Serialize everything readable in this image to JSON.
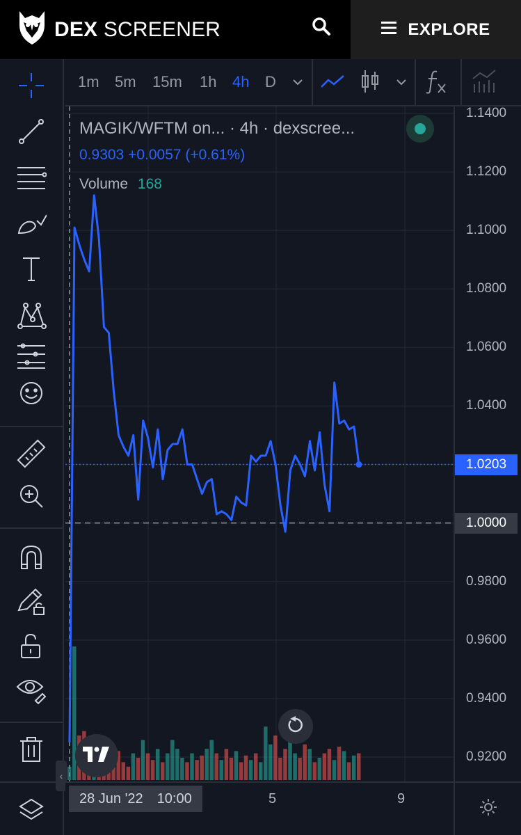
{
  "header": {
    "brand_bold": "DEX",
    "brand_light": "SCREENER",
    "explore_label": "EXPLORE"
  },
  "icons": {
    "logo": "owl-logo-icon",
    "search": "search-icon",
    "menu": "hamburger-menu-icon"
  },
  "toolbar": {
    "timeframes": [
      "1m",
      "5m",
      "15m",
      "1h",
      "4h",
      "D"
    ],
    "active_timeframe": "4h"
  },
  "legend": {
    "title": "MAGIK/WFTM on... · 4h · dexscree...",
    "price_line": "0.9303 +0.0057 (+0.61%)",
    "volume_label": "Volume",
    "volume_value": "168"
  },
  "price_axis": {
    "ticks": [
      "1.1400",
      "1.1200",
      "1.1000",
      "1.0800",
      "1.0600",
      "1.0400",
      "1.0200",
      "1.0000",
      "0.9800",
      "0.9600",
      "0.9400",
      "0.9200"
    ],
    "last_price_tag": "1.0203",
    "crosshair_price_tag": "1.0000"
  },
  "time_axis": {
    "crosshair_date": "28 Jun '22",
    "crosshair_time": "10:00",
    "labels": [
      "5",
      "9"
    ]
  },
  "colors": {
    "line": "#2962ff",
    "up_volume": "#26a69a",
    "down_volume": "#ef5350",
    "background": "#131722"
  },
  "chart_data": {
    "type": "line",
    "series": [
      {
        "values": [
          0.925,
          1.101,
          1.095,
          1.09,
          1.086,
          1.112,
          1.097,
          1.067,
          1.065,
          1.045,
          1.03,
          1.026,
          1.023,
          1.03,
          1.008,
          1.035,
          1.029,
          1.019,
          1.032,
          1.015,
          1.025,
          1.027,
          1.027,
          1.032,
          1.02,
          1.02,
          1.015,
          1.01,
          1.014,
          1.015,
          1.003,
          1.004,
          1.003,
          1.001,
          1.009,
          1.007,
          1.006,
          1.023,
          1.021,
          1.023,
          1.023,
          1.028,
          1.02,
          1.006,
          0.997,
          1.018,
          1.023,
          1.02,
          1.016,
          1.028,
          1.018,
          1.031,
          1.013,
          1.004,
          1.048,
          1.034,
          1.035,
          1.032,
          1.033,
          1.02
        ]
      },
      {
        "name": "Volume",
        "values": [
          6,
          60,
          20,
          22,
          18,
          16,
          14,
          12,
          14,
          11,
          13,
          8,
          6,
          12,
          10,
          18,
          12,
          9,
          14,
          8,
          12,
          18,
          14,
          10,
          8,
          12,
          9,
          11,
          14,
          18,
          12,
          9,
          14,
          10,
          13,
          8,
          11,
          9,
          12,
          8,
          24,
          16,
          20,
          10,
          14,
          30,
          12,
          10,
          16,
          14,
          8,
          10,
          12,
          14,
          9,
          15,
          13,
          8,
          11,
          12
        ]
      }
    ],
    "ylim": [
      0.91,
      1.14
    ],
    "reference_line": 1.0
  }
}
